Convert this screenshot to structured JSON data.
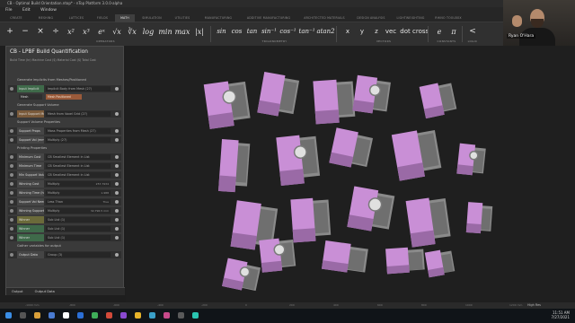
{
  "window": {
    "title": "CB - Optimal Build Orientation.ntop* - nTop Platform 3.0.0-alpha"
  },
  "menu": [
    "File",
    "Edit",
    "Window"
  ],
  "tabs": [
    "CREATE",
    "MESHING",
    "LATTICES",
    "FIELDS",
    "MATH",
    "SIMULATION",
    "UTILITIES",
    "MANUFACTURING",
    "ADDITIVE MANUFACTURING",
    "ARCHITECTED MATERIALS",
    "DESIGN ANALYSIS",
    "LIGHTWEIGHTING",
    "RHINO TOOLBOX"
  ],
  "active_tab": "MATH",
  "ribbon": {
    "groups": [
      "OPERATORS",
      "TRIGONOMETRY",
      "VECTORS",
      "CONSTANTS",
      "LOGIC"
    ],
    "operators": [
      "+",
      "−",
      "×",
      "÷",
      "x²",
      "x³",
      "eˣ",
      "√x",
      "∛x",
      "log",
      "min",
      "max",
      "|x|"
    ],
    "trig": [
      "sin",
      "cos",
      "tan",
      "sin⁻¹",
      "cos⁻¹",
      "tan⁻¹",
      "atan2"
    ],
    "vectors": [
      "x",
      "y",
      "z",
      "vec",
      "dot",
      "cross"
    ],
    "constants": [
      "e",
      "π"
    ],
    "logic": [
      "<"
    ]
  },
  "webcam": {
    "name": "Ryan O'Hara"
  },
  "panel": {
    "title": "CB - LPBF Build Quantification",
    "subtitle": "Build Time (hr) Machine Cost ($) Material Cost ($) Total Cost",
    "rows": [
      {
        "kind": "section",
        "text": "Generate implicits from Meshes/Positioned"
      },
      {
        "kind": "node",
        "style": "green",
        "name": "Input Implicit",
        "value": "Implicit Body from Mesh (27)"
      },
      {
        "kind": "section",
        "text": "Generate Support Volume"
      },
      {
        "kind": "node",
        "style": "orange",
        "name": "Input Support Mesh",
        "value": "Mesh from Voxel Grid (27)"
      },
      {
        "kind": "section",
        "text": "Support Volume Properties"
      },
      {
        "kind": "node",
        "style": "",
        "name": "Support Props",
        "value": "Mass Properties from Mesh (27)"
      },
      {
        "kind": "node",
        "style": "",
        "name": "Support Vol (mm^3)",
        "value": "Multiply (27)"
      },
      {
        "kind": "section",
        "text": "Printing Properties"
      },
      {
        "kind": "node",
        "style": "",
        "name": "Minimum Cost",
        "value": "CB Smallest Element in List"
      },
      {
        "kind": "node",
        "style": "",
        "name": "Minimum Time",
        "value": "CB Smallest Element in List"
      },
      {
        "kind": "node",
        "style": "",
        "name": "Min Support Volume",
        "value": "CB Smallest Element in List"
      },
      {
        "kind": "node",
        "style": "",
        "name": "Winning Cost",
        "value": "Multiply",
        "right": "257.7934"
      },
      {
        "kind": "node",
        "style": "",
        "name": "Winning Time (hrs)",
        "value": "Multiply",
        "right": "1.988"
      },
      {
        "kind": "node",
        "style": "",
        "name": "Support Vol Needed?",
        "value": "Less Than",
        "right": "True"
      },
      {
        "kind": "node",
        "style": "",
        "name": "Winning Support Vol",
        "value": "Multiply",
        "right": "32,796.5 mm"
      },
      {
        "kind": "node",
        "style": "yellow",
        "name": "Winner",
        "value": "Sub List (1)"
      },
      {
        "kind": "node",
        "style": "green",
        "name": "Winner",
        "value": "Sub List (1)"
      },
      {
        "kind": "node",
        "style": "green",
        "name": "Winner",
        "value": "Sub List (1)"
      },
      {
        "kind": "section",
        "text": "Gather variables for output"
      },
      {
        "kind": "node",
        "style": "",
        "name": "Output Data",
        "value": "Group (3)"
      }
    ],
    "input_implicit_options": [
      "Mesh",
      "Mesh Positioned"
    ],
    "footer": [
      "Output",
      "Output Data"
    ]
  },
  "statusbar": {
    "ruler": [
      "-1000 mm",
      "-800",
      "-600",
      "-400",
      "-200",
      "0",
      "200",
      "400",
      "600",
      "800",
      "1000",
      "1200 mm"
    ],
    "right": "High Res"
  },
  "clock": {
    "time": "11:51 AM",
    "date": "7/27/2021"
  },
  "colors": {
    "part": "#c98fd6",
    "part_shadow": "#9a6aa6",
    "support": "#8a8a8a",
    "support_dark": "#5e5e5e"
  }
}
